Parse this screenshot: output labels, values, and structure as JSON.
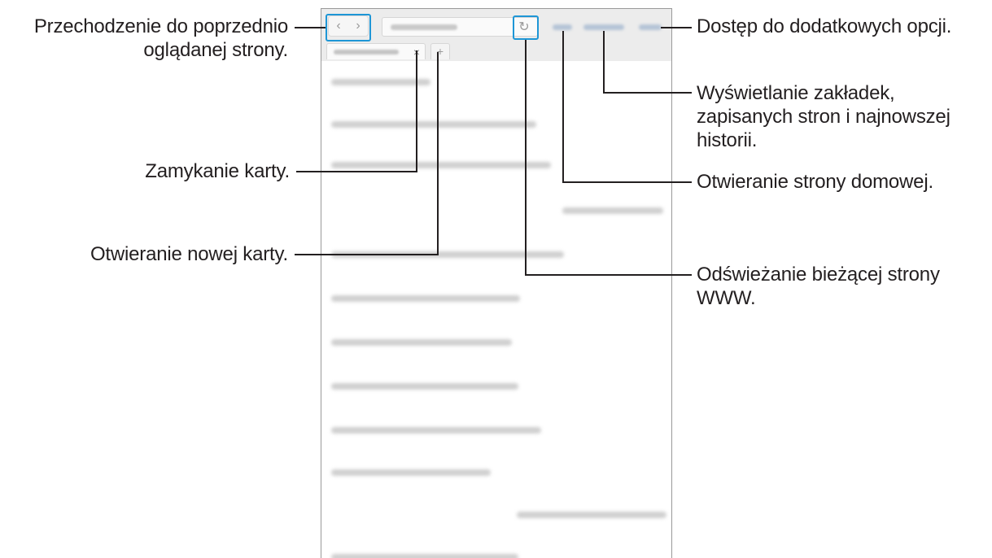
{
  "labels": {
    "back_forward": [
      "Przechodzenie do poprzednio",
      "oglądanej strony."
    ],
    "close_tab": "Zamykanie karty.",
    "new_tab": "Otwieranie nowej karty.",
    "more_options": "Dostęp do dodatkowych opcji.",
    "bookmarks": [
      "Wyświetlanie zakładek,",
      "zapisanych stron i najnowszej",
      "historii."
    ],
    "home": "Otwieranie strony domowej.",
    "refresh": [
      "Odświeżanie bieżącej strony",
      "WWW."
    ]
  },
  "browser": {
    "back_icon": "chevron-left-icon",
    "forward_icon": "chevron-right-icon",
    "back_glyph": "‹",
    "forward_glyph": "›",
    "reload_icon": "reload-icon",
    "reload_glyph": "↻",
    "close_tab_glyph": "×",
    "new_tab_glyph": "+"
  },
  "colors": {
    "callout_text": "#231f20",
    "leader_line": "#231f20",
    "toolbar_bg": "#ececec",
    "toolbar_link_blur": "#b5c4d6",
    "content_blur": "#cfcfcf"
  }
}
